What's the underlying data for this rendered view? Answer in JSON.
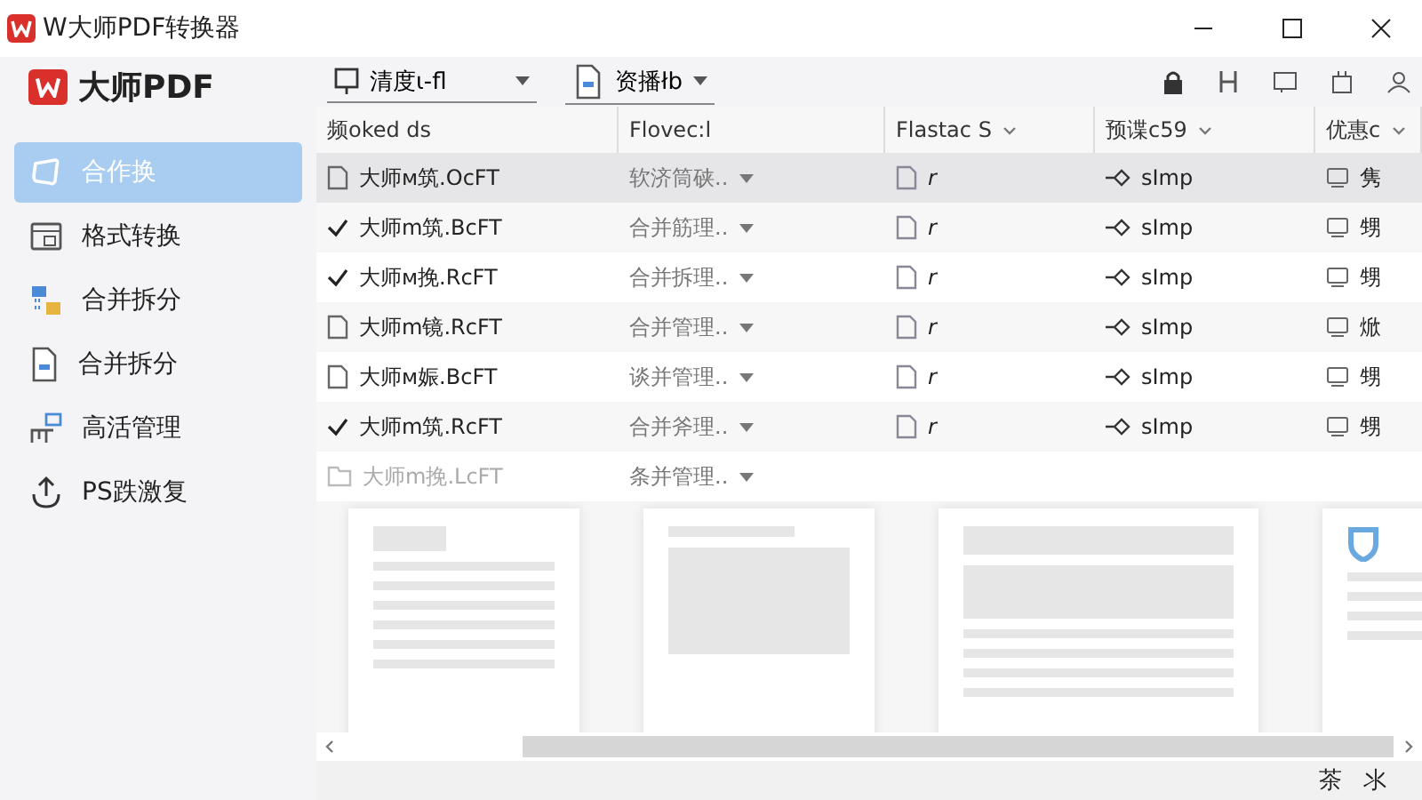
{
  "window": {
    "title": "W大师PDF转换器"
  },
  "brand": {
    "name": "大师PDF"
  },
  "sidebar": {
    "items": [
      {
        "label": "合作换",
        "selected": true
      },
      {
        "label": "格式转换",
        "selected": false
      },
      {
        "label": "合并拆分",
        "selected": false
      },
      {
        "label": "合并拆分",
        "selected": false
      },
      {
        "label": "高活管理",
        "selected": false
      },
      {
        "label": "PS跌激复",
        "selected": false
      }
    ]
  },
  "toolbar": {
    "dropdowns": [
      {
        "label": "清度ι-fl"
      },
      {
        "label": "资播łb"
      }
    ]
  },
  "table": {
    "columns": [
      "频oked ds",
      "Flovec:l",
      "Flastac S",
      "预谍c59",
      "优惠c"
    ],
    "rows": [
      {
        "kind": "file",
        "name": "大师м筑.OcFT",
        "type": "软济筒硖..",
        "flag": "r",
        "mode": "sImp",
        "extra": "隽",
        "selected": true,
        "faded": false
      },
      {
        "kind": "check",
        "name": "大师m筑.BcFT",
        "type": "合并筋理..",
        "flag": "r",
        "mode": "sImp",
        "extra": "甥",
        "selected": false,
        "faded": false
      },
      {
        "kind": "check",
        "name": "大师м挽.RcFT",
        "type": "合并拆理..",
        "flag": "r",
        "mode": "sImp",
        "extra": "甥",
        "selected": false,
        "faded": false
      },
      {
        "kind": "file",
        "name": "大师m镜.RcFT",
        "type": "合并管理..",
        "flag": "r",
        "mode": "sImp",
        "extra": "焮",
        "selected": false,
        "faded": false
      },
      {
        "kind": "file",
        "name": "大师м娠.BcFT",
        "type": "谈并管理..",
        "flag": "r",
        "mode": "sImp",
        "extra": "甥",
        "selected": false,
        "faded": false
      },
      {
        "kind": "check",
        "name": "大师m筑.RcFT",
        "type": "合并斧理..",
        "flag": "r",
        "mode": "sImp",
        "extra": "甥",
        "selected": false,
        "faded": false
      },
      {
        "kind": "folder",
        "name": "大师m挽.LcFT",
        "type": "条并管理..",
        "selected": false,
        "faded": true
      }
    ]
  },
  "status_bar": {
    "items": [
      "茶",
      "氺"
    ]
  }
}
